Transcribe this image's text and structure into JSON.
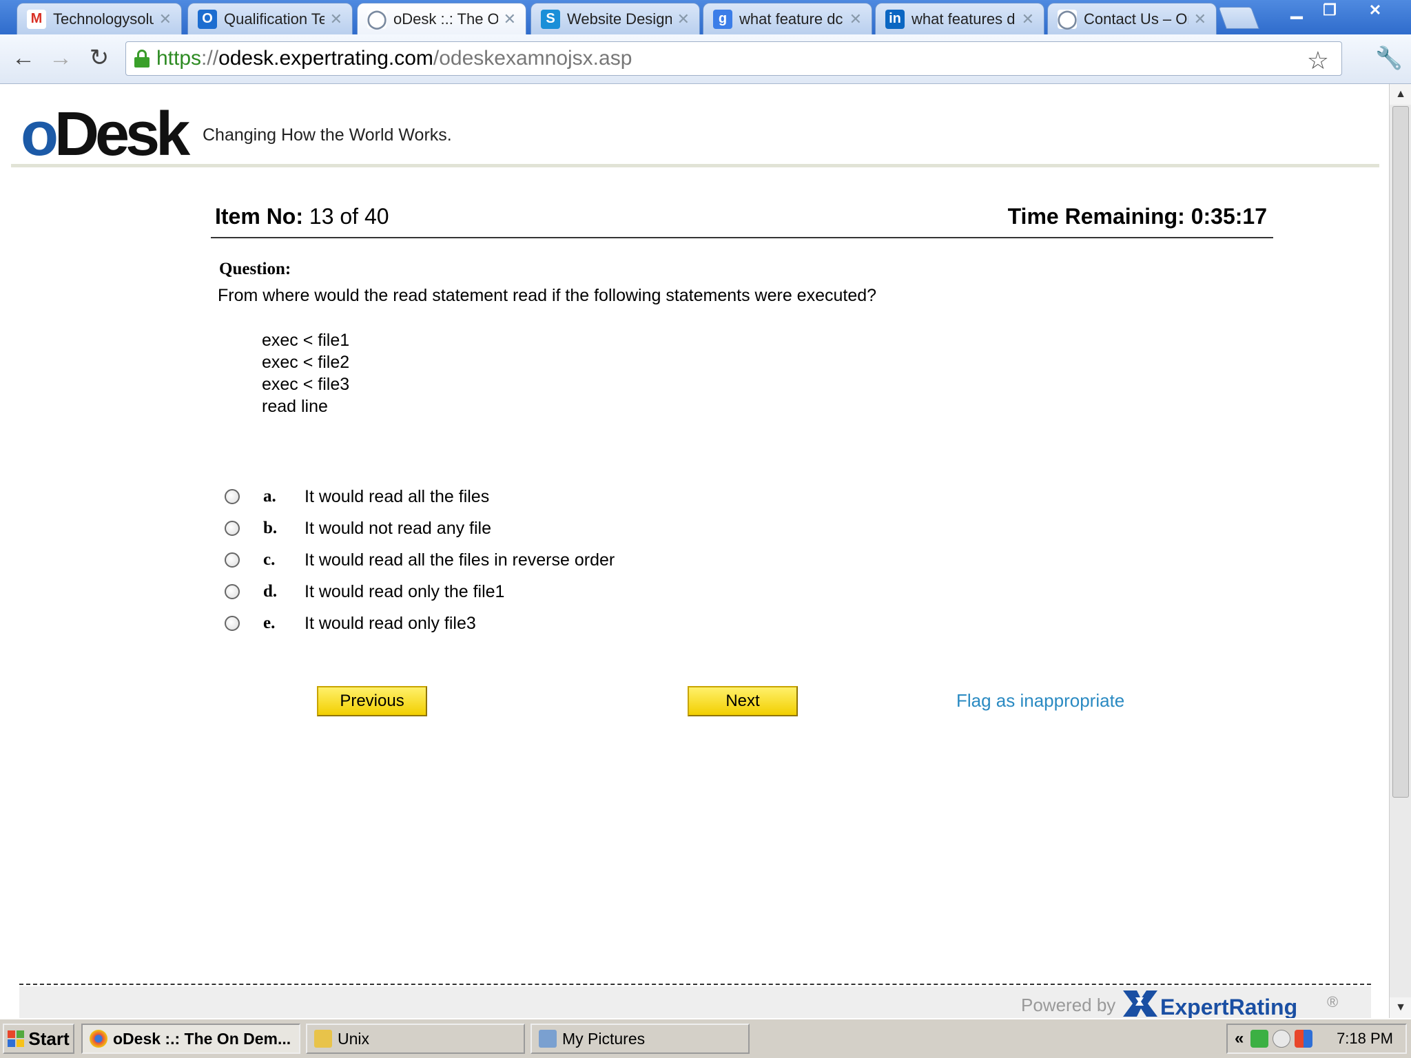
{
  "browser": {
    "tabs": [
      {
        "title": "Technologysolut",
        "icon": "gmail-icon",
        "favicon_text": "M",
        "color": "#d93025"
      },
      {
        "title": "Qualification Te",
        "icon": "odesk-icon",
        "favicon_text": "O",
        "color": "#1c6dd0"
      },
      {
        "title": "oDesk :.: The O",
        "icon": "globe-icon",
        "favicon_text": "◯",
        "color": "#7a8aa0"
      },
      {
        "title": "Website Design,",
        "icon": "skype-icon",
        "favicon_text": "S",
        "color": "#1a8fd8"
      },
      {
        "title": "what feature dc",
        "icon": "google-icon",
        "favicon_text": "g",
        "color": "#3b7de8"
      },
      {
        "title": "what features d",
        "icon": "linkedin-icon",
        "favicon_text": "in",
        "color": "#0a66c2"
      },
      {
        "title": "Contact Us – Or",
        "icon": "globe-icon",
        "favicon_text": "◯",
        "color": "#7a8aa0"
      }
    ],
    "url": {
      "scheme": "https",
      "sep": "://",
      "host": "odesk.expertrating.com",
      "path": "/odeskexamnojsx.asp"
    }
  },
  "page": {
    "logo": {
      "o": "o",
      "rest": "Desk"
    },
    "tagline": "Changing How the World Works.",
    "item_label": "Item No:",
    "item_value": "13 of 40",
    "timer_label": "Time Remaining:",
    "timer_value": "0:35:17",
    "question_label": "Question:",
    "question_text": "From where would the read statement read if the following statements were executed?",
    "code_lines": [
      "exec < file1",
      "exec < file2",
      "exec < file3",
      "read line"
    ],
    "options": [
      {
        "letter": "a.",
        "text": "It would read all the files"
      },
      {
        "letter": "b.",
        "text": "It would not read any file"
      },
      {
        "letter": "c.",
        "text": "It would read all the files in reverse order"
      },
      {
        "letter": "d.",
        "text": "It would read only the file1"
      },
      {
        "letter": "e.",
        "text": "It would read only file3"
      }
    ],
    "previous_label": "Previous",
    "next_label": "Next",
    "flag_label": "Flag as inappropriate",
    "powered_by": "Powered by",
    "expertrating_name": "ExpertRating",
    "registered": "®"
  },
  "taskbar": {
    "start_label": "Start",
    "tasks": [
      {
        "label": "oDesk :.: The On Dem...",
        "icon": "chrome-icon",
        "color": "#dd4433"
      },
      {
        "label": "Unix",
        "icon": "folder-icon",
        "color": "#e8c34a"
      },
      {
        "label": "My Pictures",
        "icon": "folder-pictures-icon",
        "color": "#7aa0d0"
      }
    ],
    "tray_chevron": "«",
    "clock": "7:18 PM"
  },
  "colors": {
    "button_yellow": "#f7de1c",
    "flag_link": "#2a8ac2",
    "odesk_blue": "#1c5aa7",
    "expertrating_blue": "#1a4fa3"
  }
}
